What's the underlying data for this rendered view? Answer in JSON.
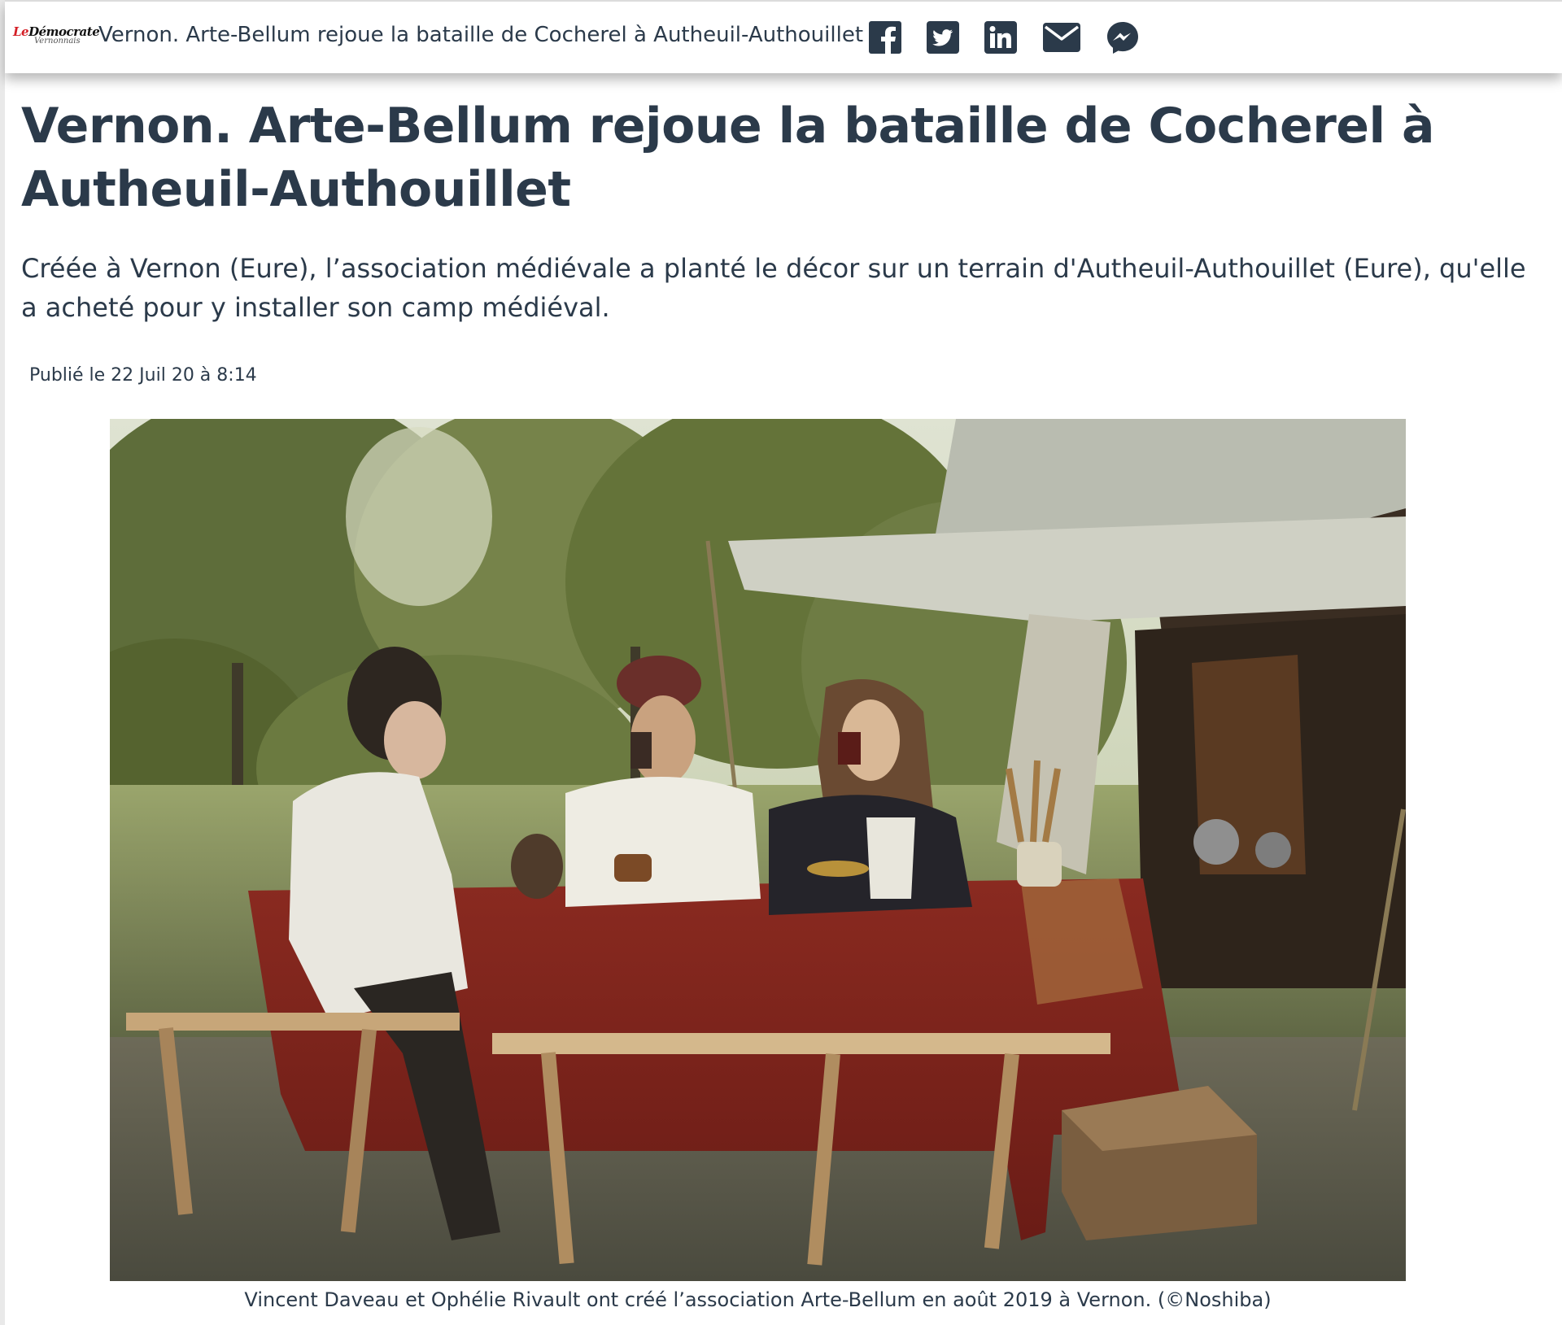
{
  "header": {
    "logo_text_top_1": "Le",
    "logo_text_top_2": "Démocrate",
    "logo_text_bottom": "Vernonnais",
    "title": "Vernon. Arte-Bellum rejoue la bataille de Cocherel à Autheuil-Authouillet",
    "share": [
      {
        "name": "facebook-icon"
      },
      {
        "name": "twitter-icon"
      },
      {
        "name": "linkedin-icon"
      },
      {
        "name": "mail-icon"
      },
      {
        "name": "messenger-icon"
      }
    ]
  },
  "article": {
    "headline": "Vernon. Arte-Bellum rejoue la bataille de Cocherel à Autheuil-Authouillet",
    "lead": "Créée à Vernon (Eure), l’association médiévale a planté le décor sur un terrain d'Autheuil-Authouillet (Eure), qu'elle a acheté pour y installer son camp médiéval.",
    "published": "Publié le 22 Juil 20 à 8:14",
    "caption": "Vincent Daveau et Ophélie Rivault ont créé l’association Arte-Bellum en août 2019 à Vernon. (©Noshiba)"
  },
  "colors": {
    "text": "#2b3a4a",
    "logo_red": "#d41f26",
    "icon": "#2b3a4a"
  }
}
